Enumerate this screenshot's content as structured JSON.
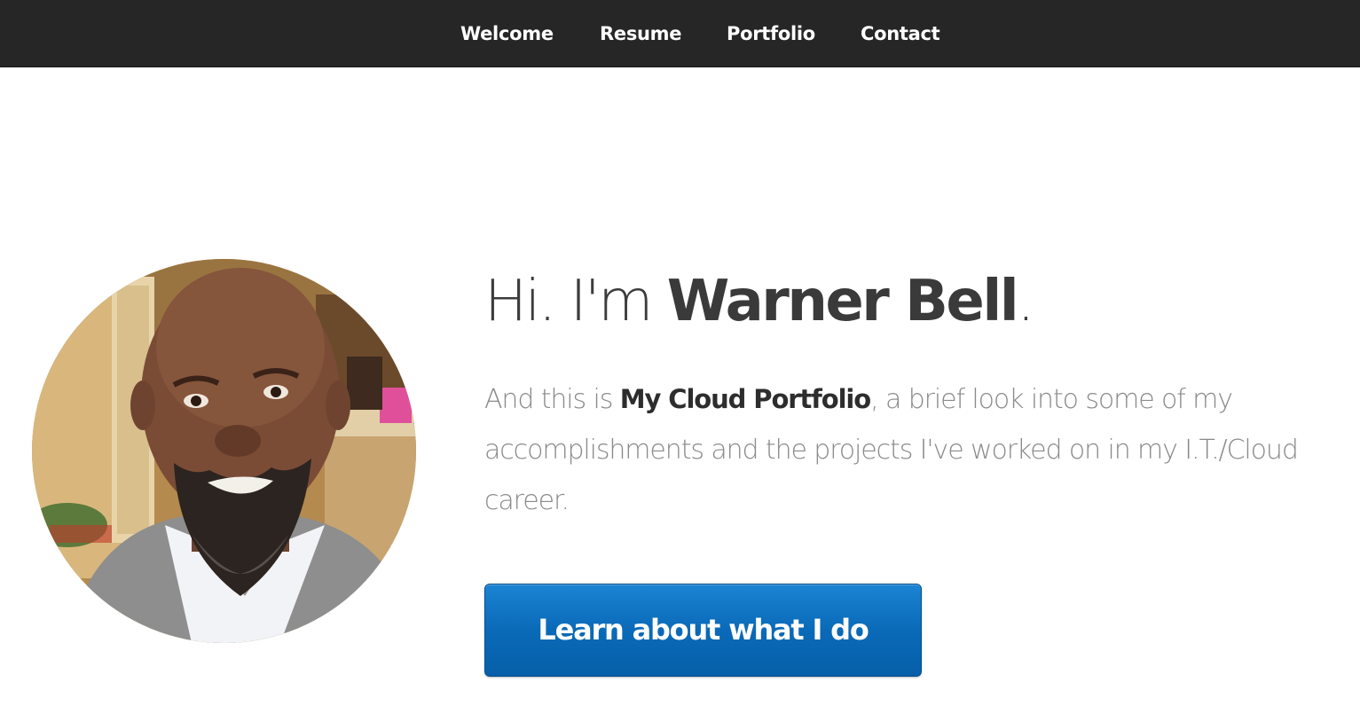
{
  "nav": {
    "items": [
      {
        "label": "Welcome"
      },
      {
        "label": "Resume"
      },
      {
        "label": "Portfolio"
      },
      {
        "label": "Contact"
      }
    ]
  },
  "hero": {
    "greeting": "Hi. I'm ",
    "name": "Warner Bell",
    "period": ".",
    "intro_prefix": "And this is ",
    "intro_highlight": "My Cloud Portfolio",
    "intro_suffix": ", a brief look into some of my accomplishments and the projects I've worked on in my I.T./Cloud career.",
    "cta_label": "Learn about what I do"
  },
  "colors": {
    "navbar_bg": "#262626",
    "cta_blue": "#0a6ab8",
    "heading_text": "#3c3c3c",
    "body_text": "#8a8a8a"
  }
}
